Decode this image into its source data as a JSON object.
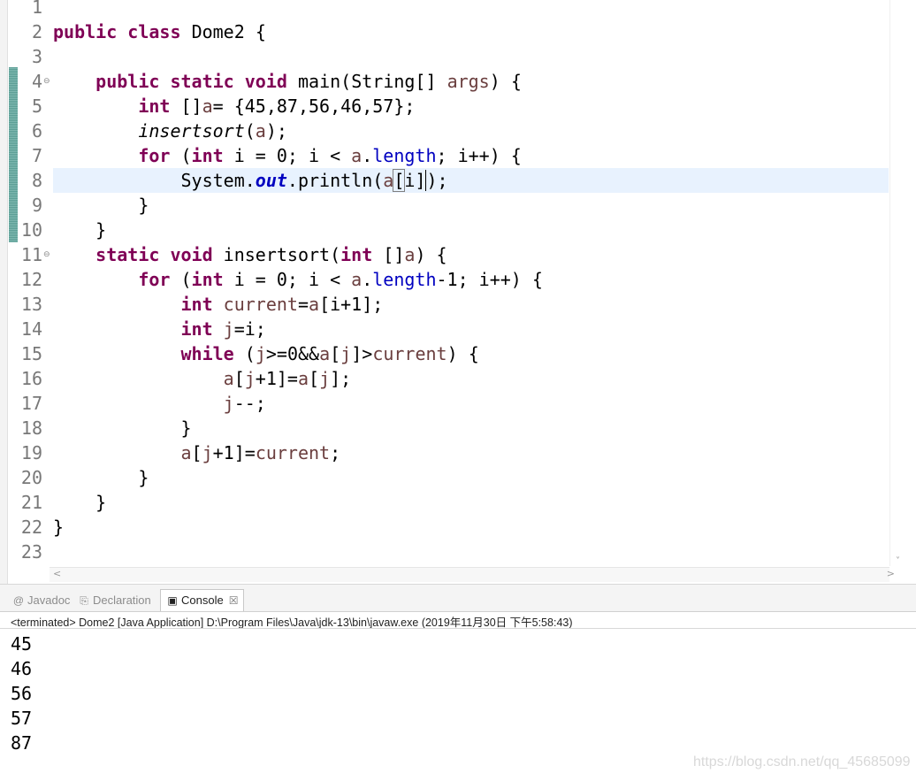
{
  "editor": {
    "lines": [
      {
        "n": "1",
        "fold": false
      },
      {
        "n": "2",
        "fold": false
      },
      {
        "n": "3",
        "fold": false
      },
      {
        "n": "4",
        "fold": true
      },
      {
        "n": "5",
        "fold": false
      },
      {
        "n": "6",
        "fold": false
      },
      {
        "n": "7",
        "fold": false
      },
      {
        "n": "8",
        "fold": false
      },
      {
        "n": "9",
        "fold": false
      },
      {
        "n": "10",
        "fold": false
      },
      {
        "n": "11",
        "fold": true
      },
      {
        "n": "12",
        "fold": false
      },
      {
        "n": "13",
        "fold": false
      },
      {
        "n": "14",
        "fold": false
      },
      {
        "n": "15",
        "fold": false
      },
      {
        "n": "16",
        "fold": false
      },
      {
        "n": "17",
        "fold": false
      },
      {
        "n": "18",
        "fold": false
      },
      {
        "n": "19",
        "fold": false
      },
      {
        "n": "20",
        "fold": false
      },
      {
        "n": "21",
        "fold": false
      },
      {
        "n": "22",
        "fold": false
      },
      {
        "n": "23",
        "fold": false
      }
    ],
    "fold_glyph": "⊖",
    "code": {
      "l2": {
        "kw1": "public",
        "kw2": "class",
        "name": "Dome2",
        "brace": "{"
      },
      "l4": {
        "indent": "    ",
        "kw1": "public",
        "kw2": "static",
        "kw3": "void",
        "sig": "main(String[] ",
        "param": "args",
        "tail": ") {"
      },
      "l5": {
        "indent": "        ",
        "kw": "int",
        "t1": " []",
        "var": "a",
        "t2": "= {45,87,56,46,57};"
      },
      "l6": {
        "indent": "        ",
        "call": "insertsort",
        "t1": "(",
        "var": "a",
        "t2": ");"
      },
      "l7": {
        "indent": "        ",
        "kw": "for",
        "t1": " (",
        "kw2": "int",
        "t2": " i = 0; i < ",
        "var": "a",
        "dot": ".",
        "fld": "length",
        "t3": "; i++) {"
      },
      "l8": {
        "indent": "            ",
        "t1": "System.",
        "sfld": "out",
        "t2": ".println(",
        "var": "a",
        "lb": "[",
        "idx": "i",
        "rb": "]",
        "t3": ");"
      },
      "l9": {
        "indent": "        ",
        "t": "}"
      },
      "l10": {
        "indent": "    ",
        "t": "}"
      },
      "l11": {
        "indent": "    ",
        "kw1": "static",
        "kw2": "void",
        "t1": " insertsort(",
        "kw3": "int",
        "t2": " []",
        "var": "a",
        "t3": ") {"
      },
      "l12": {
        "indent": "        ",
        "kw": "for",
        "t1": " (",
        "kw2": "int",
        "t2": " i = 0; i < ",
        "var": "a",
        "dot": ".",
        "fld": "length",
        "t3": "-1; i++) {"
      },
      "l13": {
        "indent": "            ",
        "kw": "int",
        "t1": " ",
        "var": "current",
        "t2": "=",
        "var2": "a",
        "t3": "[i+1];"
      },
      "l14": {
        "indent": "            ",
        "kw": "int",
        "t1": " ",
        "var": "j",
        "t2": "=i;"
      },
      "l15": {
        "indent": "            ",
        "kw": "while",
        "t1": " (",
        "v1": "j",
        "t2": ">=0&&",
        "v2": "a",
        "t3": "[",
        "v3": "j",
        "t4": "]>",
        "v4": "current",
        "t5": ") {"
      },
      "l16": {
        "indent": "                ",
        "v1": "a",
        "t1": "[",
        "v2": "j",
        "t2": "+1]=",
        "v3": "a",
        "t3": "[",
        "v4": "j",
        "t4": "];"
      },
      "l17": {
        "indent": "                ",
        "v1": "j",
        "t1": "--;"
      },
      "l18": {
        "indent": "            ",
        "t": "}"
      },
      "l19": {
        "indent": "            ",
        "v1": "a",
        "t1": "[",
        "v2": "j",
        "t2": "+1]=",
        "v3": "current",
        "t3": ";"
      },
      "l20": {
        "indent": "        ",
        "t": "}"
      },
      "l21": {
        "indent": "    ",
        "t": "}"
      },
      "l22": {
        "indent": "",
        "t": "}"
      }
    },
    "scroll": {
      "up": "˄",
      "down": "˅",
      "left": "<",
      "right": ">"
    }
  },
  "panel": {
    "tabs": [
      {
        "icon": "@",
        "label": "Javadoc"
      },
      {
        "icon": "⎘",
        "label": "Declaration"
      },
      {
        "icon": "▣",
        "label": "Console",
        "close": "☒"
      }
    ],
    "status": "<terminated> Dome2 [Java Application] D:\\Program Files\\Java\\jdk-13\\bin\\javaw.exe (2019年11月30日 下午5:58:43)",
    "output": [
      "45",
      "46",
      "56",
      "57",
      "87"
    ]
  },
  "watermark": "https://blog.csdn.net/qq_45685099",
  "colors": {
    "keyword": "#7f0055",
    "variable": "#6a3e3e",
    "field": "#0000c0",
    "current_line": "#e8f2fe"
  }
}
